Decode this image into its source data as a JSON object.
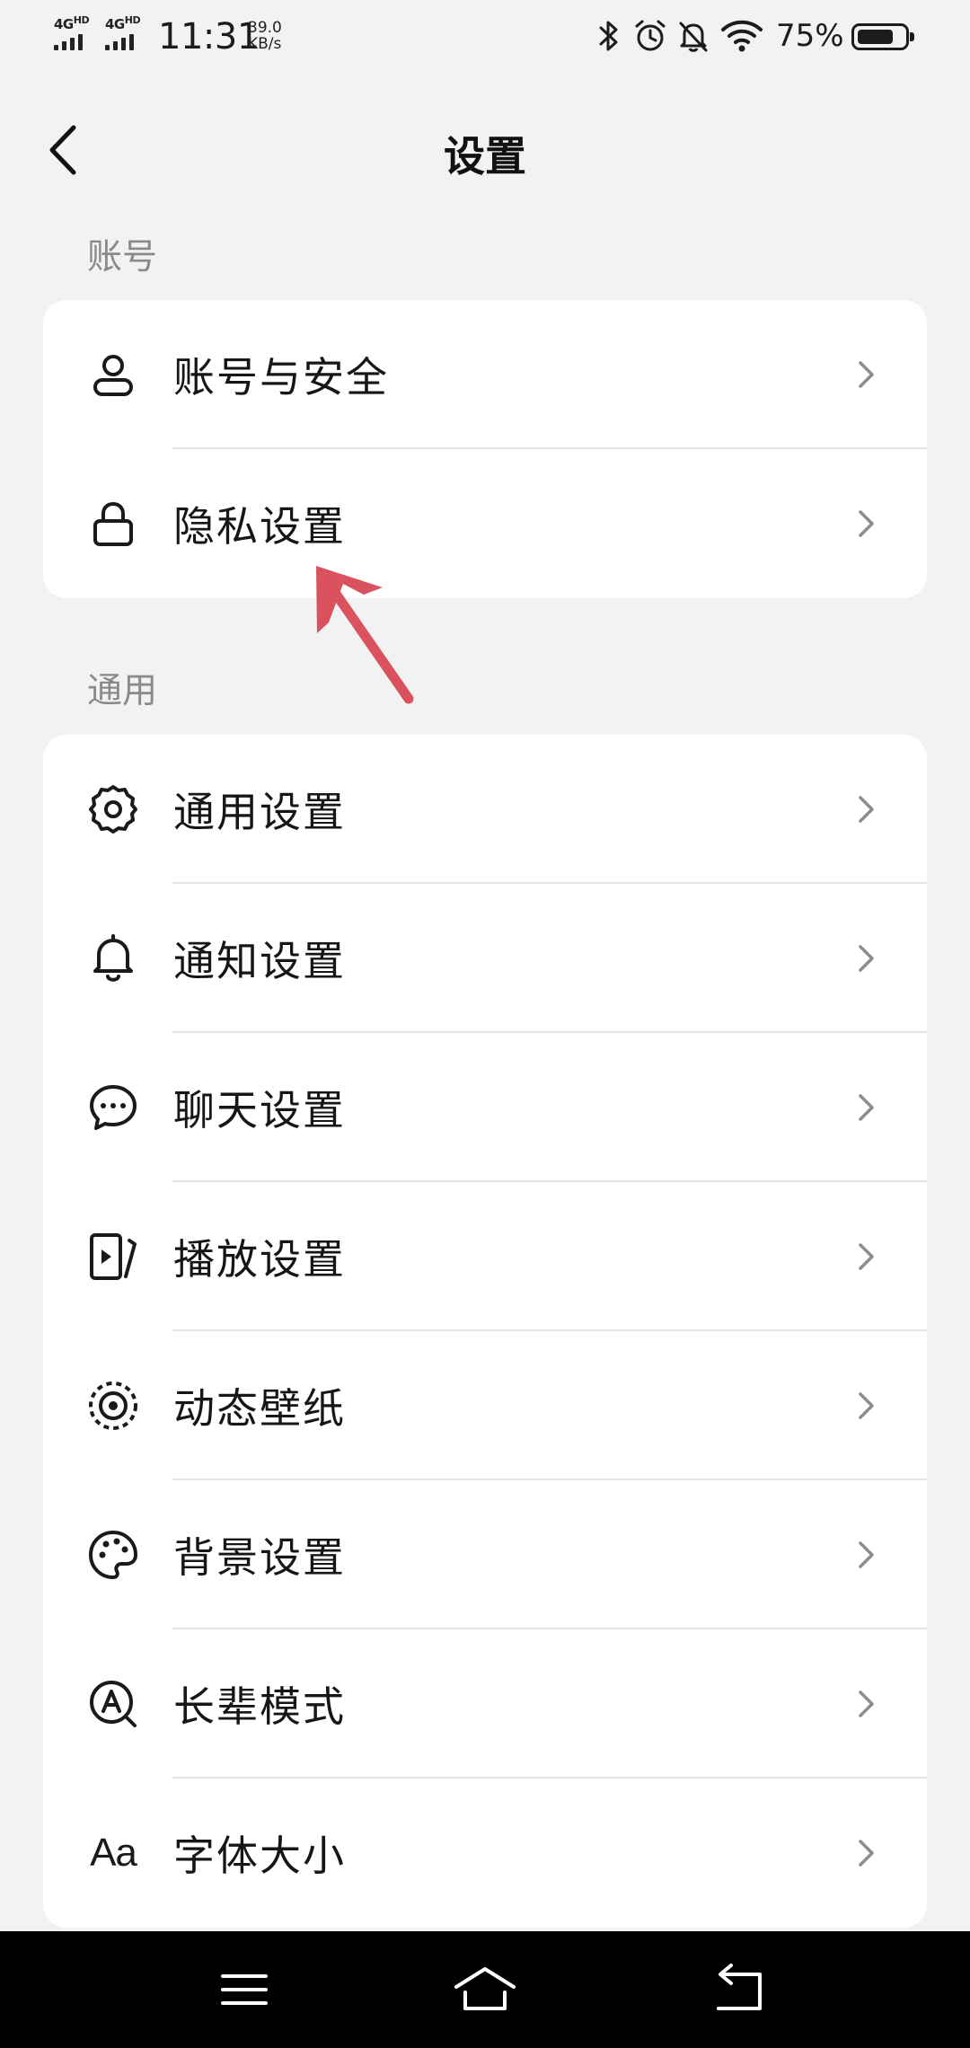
{
  "status_bar": {
    "network1": "4G",
    "network1_sup": "HD",
    "network2": "4G",
    "network2_sup": "HD",
    "time": "11:31",
    "speed_value": "39.0",
    "speed_unit": "KB/s",
    "battery_percent": "75%",
    "battery_level": 0.75,
    "icons": [
      "bluetooth-icon",
      "alarm-icon",
      "bell-off-icon",
      "wifi-icon",
      "battery-icon"
    ]
  },
  "nav": {
    "title": "设置",
    "back_icon": "chevron-left-icon"
  },
  "sections": {
    "account": {
      "label": "账号",
      "items": [
        {
          "label": "账号与安全",
          "icon": "person-icon"
        },
        {
          "label": "隐私设置",
          "icon": "lock-icon"
        }
      ]
    },
    "general": {
      "label": "通用",
      "items": [
        {
          "label": "通用设置",
          "icon": "gear-icon"
        },
        {
          "label": "通知设置",
          "icon": "bell-icon"
        },
        {
          "label": "聊天设置",
          "icon": "chat-bubble-icon"
        },
        {
          "label": "播放设置",
          "icon": "play-icon"
        },
        {
          "label": "动态壁纸",
          "icon": "live-wallpaper-icon"
        },
        {
          "label": "背景设置",
          "icon": "palette-icon"
        },
        {
          "label": "长辈模式",
          "icon": "elder-mode-icon"
        },
        {
          "label": "字体大小",
          "icon": "font-size-icon",
          "icon_text": "Aa"
        }
      ]
    }
  },
  "colors": {
    "page_background": "#f2f2f2",
    "card_background": "#ffffff",
    "section_label": "#8a8a8a",
    "annotation_arrow": "#d9525e",
    "system_nav_background": "#000000"
  },
  "system_nav": {
    "icons": [
      "menu-icon",
      "home-icon",
      "back-icon"
    ]
  }
}
